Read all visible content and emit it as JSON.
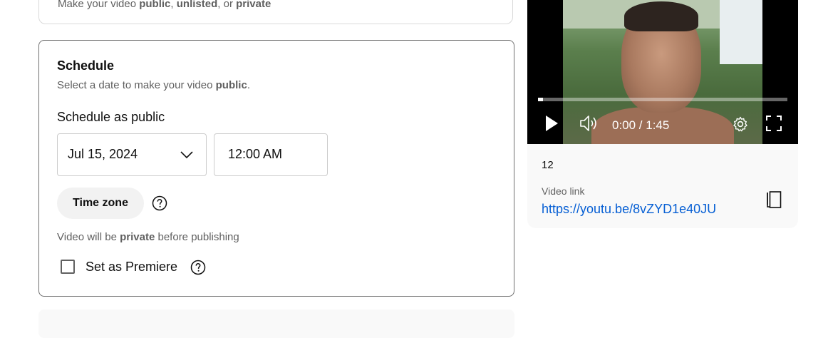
{
  "visibility": {
    "subtitle_prefix": "Make your video ",
    "opt_public": "public",
    "sep1": ", ",
    "opt_unlisted": "unlisted",
    "sep2": ", or ",
    "opt_private": "private"
  },
  "schedule": {
    "title": "Schedule",
    "subtitle_prefix": "Select a date to make your video ",
    "subtitle_bold": "public",
    "subtitle_suffix": ".",
    "as_public_label": "Schedule as public",
    "date_value": "Jul 15, 2024",
    "time_value": "12:00 AM",
    "timezone_button": "Time zone",
    "private_prefix": "Video will be ",
    "private_bold": "private",
    "private_suffix": " before publishing",
    "premiere_label": "Set as Premiere",
    "premiere_checked": false
  },
  "player": {
    "time_readout": "0:00 / 1:45",
    "progress_fraction": 0.02
  },
  "video_info": {
    "title": "12",
    "link_label": "Video link",
    "link_url": "https://youtu.be/8vZYD1e40JU"
  },
  "icons": {
    "dropdown": "chevron-down-icon",
    "help": "help-circle-icon",
    "play": "play-icon",
    "volume": "volume-icon",
    "settings": "gear-icon",
    "fullscreen": "fullscreen-icon",
    "copy": "copy-icon"
  },
  "colors": {
    "link": "#065fd4",
    "secondary_text": "#606060",
    "chip_bg": "#f2f2f2"
  }
}
